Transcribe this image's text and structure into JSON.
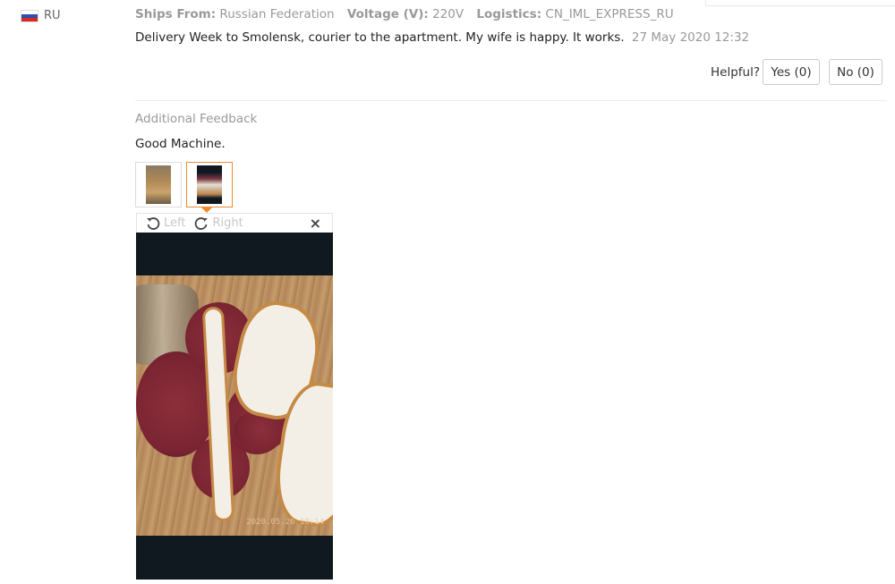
{
  "review": {
    "country": "RU",
    "ships_from_label": "Ships From:",
    "ships_from_value": "Russian Federation",
    "voltage_label": "Voltage (V):",
    "voltage_value": "220V",
    "logistics_label": "Logistics:",
    "logistics_value": "CN_IML_EXPRESS_RU",
    "text": "Delivery Week to Smolensk, courier to the apartment. My wife is happy. It works.",
    "date": "27 May 2020 12:32"
  },
  "helpful": {
    "label": "Helpful?",
    "yes_label": "Yes (0)",
    "no_label": "No (0)"
  },
  "additional": {
    "title": "Additional Feedback",
    "text": "Good Machine."
  },
  "viewer": {
    "rotate_left_label": "Left",
    "rotate_right_label": "Right",
    "close_glyph": "×",
    "photo_timestamp": "2020.05.26 10:14"
  },
  "colors": {
    "accent": "#f08a2c",
    "muted_text": "#999999",
    "viewer_bg": "#101820"
  }
}
